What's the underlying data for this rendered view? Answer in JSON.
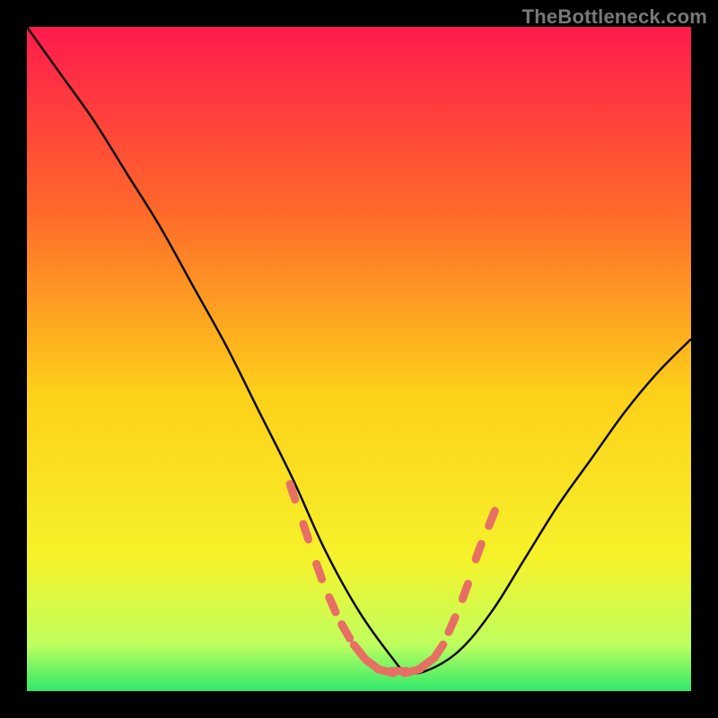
{
  "watermark": "TheBottleneck.com",
  "colors": {
    "bg_black": "#000000",
    "grad_top": "#ff1a4d",
    "grad_mid1": "#ff6a2a",
    "grad_mid2": "#fdd01a",
    "grad_mid3": "#f6f22a",
    "grad_bottom_light": "#bfff5e",
    "grad_bottom": "#2fe86b",
    "curve_stroke": "#0d0a08",
    "accent_salmon": "#e76f63"
  },
  "chart_data": {
    "type": "line",
    "title": "",
    "xlabel": "",
    "ylabel": "",
    "xlim": [
      0,
      100
    ],
    "ylim": [
      0,
      100
    ],
    "x": [
      0,
      5,
      10,
      15,
      20,
      25,
      30,
      35,
      40,
      45,
      50,
      55,
      57,
      60,
      65,
      70,
      75,
      80,
      85,
      90,
      95,
      100
    ],
    "values": [
      100,
      93,
      86,
      78,
      70,
      61,
      52,
      42,
      32,
      21,
      12,
      5,
      3,
      3,
      6,
      12,
      20,
      28,
      35,
      42,
      48,
      53
    ],
    "annotations_x": [
      40,
      42,
      44,
      46,
      48,
      50,
      52,
      54,
      56,
      58,
      60,
      62,
      64,
      66,
      68,
      70
    ],
    "annotations_y": [
      30,
      24,
      18,
      13,
      9,
      6,
      4,
      3,
      3,
      3,
      4,
      6,
      10,
      15,
      21,
      26
    ]
  }
}
